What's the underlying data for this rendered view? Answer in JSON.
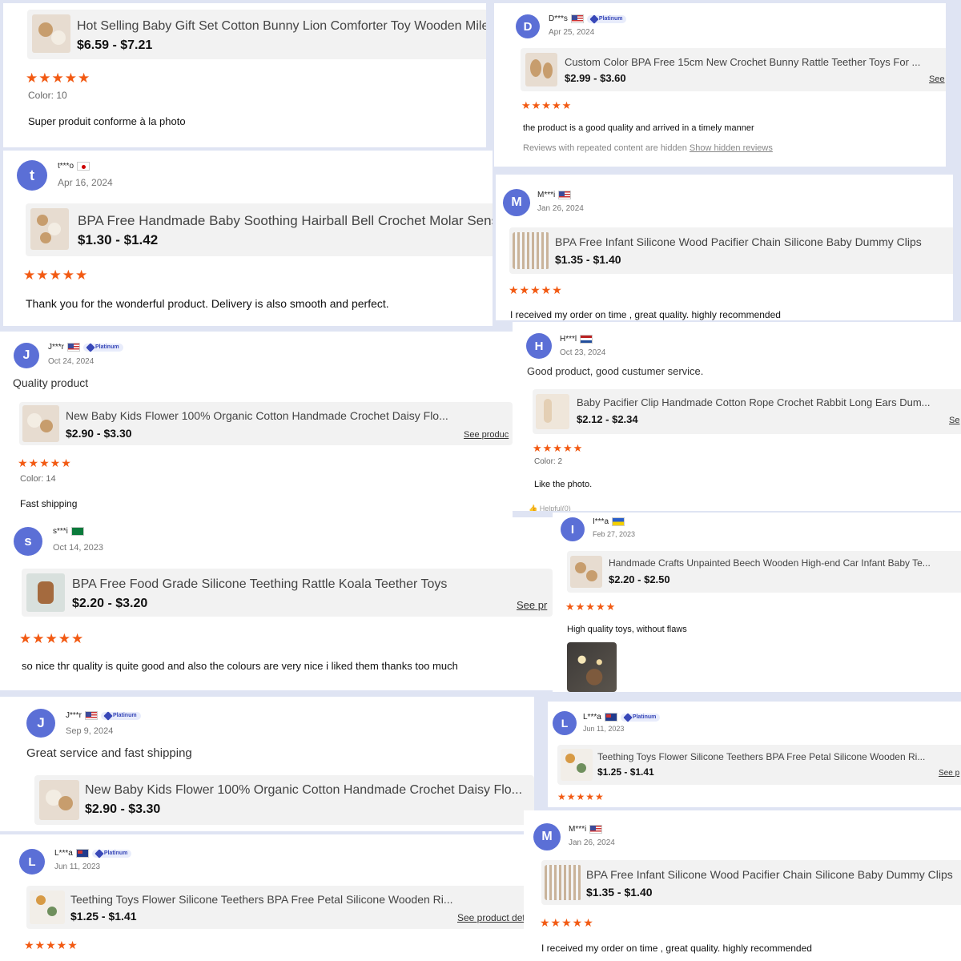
{
  "colors": {
    "accent": "#5b6fd6",
    "star": "#f25a13",
    "background": "#dfe4f3"
  },
  "icons": {
    "star": "★",
    "platinum_badge": "diamond-icon",
    "helpful": "thumbs-up-icon"
  },
  "reviews": [
    {
      "product_title": "Hot Selling Baby Gift Set Cotton Bunny Lion Comforter Toy Wooden Mile",
      "price": "$6.59 - $7.21",
      "stars": "★★★★★",
      "color": "Color: 10",
      "text": "Super produit conforme à la photo"
    },
    {
      "avatar": "D",
      "user": "D***s",
      "date": "Apr 25, 2024",
      "badge": "Platinum",
      "product_title": "Custom Color BPA Free 15cm New Crochet Bunny Rattle Teether Toys For ...",
      "price": "$2.99 - $3.60",
      "see": "See",
      "stars": "★★★★★",
      "text": "the product is a good quality and arrived in a timely manner",
      "hidden_note": "Reviews with repeated content are hidden",
      "hidden_link": "Show hidden reviews"
    },
    {
      "avatar": "t",
      "user": "t***o",
      "date": "Apr 16, 2024",
      "product_title": "BPA Free Handmade Baby Soothing Hairball Bell Crochet Molar Senso",
      "price": "$1.30 - $1.42",
      "stars": "★★★★★",
      "text": "Thank you for the wonderful product. Delivery is also smooth and perfect."
    },
    {
      "avatar": "M",
      "user": "M***i",
      "date": "Jan 26, 2024",
      "product_title": "BPA Free Infant Silicone Wood Pacifier Chain Silicone Baby Dummy Clips",
      "price": "$1.35 - $1.40",
      "stars": "★★★★★",
      "text": "I received my order on time , great quality. highly recommended"
    },
    {
      "avatar": "J",
      "user": "J***r",
      "date": "Oct 24, 2024",
      "badge": "Platinum",
      "headline": "Quality product",
      "product_title": "New Baby Kids Flower 100% Organic Cotton Handmade Crochet Daisy Flo...",
      "price": "$2.90 - $3.30",
      "see": "See produc",
      "stars": "★★★★★",
      "color": "Color: 14",
      "text": "Fast shipping"
    },
    {
      "avatar": "H",
      "user": "H***l",
      "date": "Oct 23, 2024",
      "headline": "Good product, good custumer service.",
      "product_title": "Baby Pacifier Clip Handmade Cotton Rope Crochet Rabbit Long Ears Dum...",
      "price": "$2.12 - $2.34",
      "see": "Se",
      "stars": "★★★★★",
      "color": "Color: 2",
      "text": "Like the photo.",
      "helpful": "Helpful(0)"
    },
    {
      "avatar": "s",
      "user": "s***i",
      "date": "Oct 14, 2023",
      "product_title": "BPA Free Food Grade Silicone Teething Rattle Koala Teether Toys",
      "price": "$2.20 - $3.20",
      "see": "See pr",
      "stars": "★★★★★",
      "text": "so nice thr quality is quite good and also the colours are very nice i liked them thanks too much"
    },
    {
      "avatar": "I",
      "user": "I***a",
      "date": "Feb 27, 2023",
      "product_title": "Handmade Crafts Unpainted Beech Wooden High-end Car Infant Baby Te...",
      "price": "$2.20 - $2.50",
      "stars": "★★★★★",
      "text": "High quality toys, without flaws"
    },
    {
      "avatar": "J",
      "user": "J***r",
      "date": "Sep 9, 2024",
      "badge": "Platinum",
      "headline": "Great service and fast shipping",
      "product_title": "New Baby Kids Flower 100% Organic Cotton Handmade Crochet Daisy Flo...",
      "price": "$2.90 - $3.30"
    },
    {
      "avatar": "L",
      "user": "L***a",
      "date": "Jun 11, 2023",
      "badge": "Platinum",
      "product_title": "Teething Toys Flower Silicone Teethers BPA Free Petal Silicone Wooden Ri...",
      "price": "$1.25 - $1.41",
      "see": "See p",
      "stars": "★★★★★"
    },
    {
      "avatar": "L",
      "user": "L***a",
      "date": "Jun 11, 2023",
      "badge": "Platinum",
      "product_title": "Teething Toys Flower Silicone Teethers BPA Free Petal Silicone Wooden Ri...",
      "price": "$1.25 - $1.41",
      "see": "See product detail",
      "stars": "★★★★★"
    },
    {
      "avatar": "M",
      "user": "M***i",
      "date": "Jan 26, 2024",
      "product_title": "BPA Free Infant Silicone Wood Pacifier Chain Silicone Baby Dummy Clips",
      "price": "$1.35 - $1.40",
      "stars": "★★★★★",
      "text": "I received my order on time , great quality. highly recommended"
    }
  ]
}
